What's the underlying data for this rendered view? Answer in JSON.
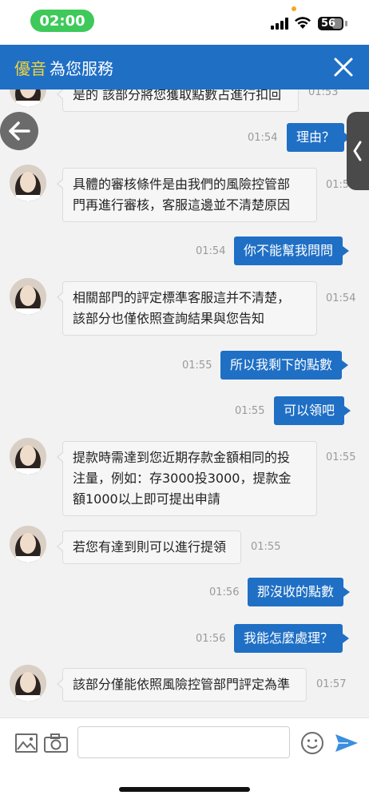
{
  "status_bar": {
    "time": "02:00",
    "battery": "56"
  },
  "header": {
    "brand": "優音",
    "title": "為您服務"
  },
  "messages": [
    {
      "from": "agent",
      "text": "是的 該部分將您獲取點數占進行扣回",
      "time": "01:53"
    },
    {
      "from": "user",
      "text": "理由？",
      "time": "01:54"
    },
    {
      "from": "agent",
      "text": "具體的審核條件是由我們的風險控管部門再進行審核，客服這邊並不清楚原因",
      "line1": "具體的審核條件是由我們的風險控管部",
      "line2": "門再進行審核，客服這邊並不清楚原因",
      "time": "01:54"
    },
    {
      "from": "user",
      "text": "你不能幫我問問",
      "time": "01:54"
    },
    {
      "from": "agent",
      "line1": "相關部門的評定標準客服這并不清楚，",
      "line2": "該部分也僅依照查詢結果與您告知",
      "time": "01:54"
    },
    {
      "from": "user",
      "text": "所以我剩下的點數",
      "time": "01:55"
    },
    {
      "from": "user",
      "text": "可以領吧",
      "time": "01:55"
    },
    {
      "from": "agent",
      "line1": "提款時需達到您近期存款金額相同的投",
      "line2": "注量，例如：存3000投3000，提款金",
      "line3": "額1000以上即可提出申請",
      "time": "01:55"
    },
    {
      "from": "agent",
      "text": "若您有達到則可以進行提領",
      "time": "01:55"
    },
    {
      "from": "user",
      "text": "那沒收的點數",
      "time": "01:56"
    },
    {
      "from": "user",
      "text": "我能怎麼處理？",
      "time": "01:56"
    },
    {
      "from": "agent",
      "text": "該部分僅能依照風險控管部門評定為準",
      "time": "01:57"
    }
  ],
  "input": {
    "placeholder": ""
  },
  "colors": {
    "primary": "#1f6fc5",
    "brand": "#f2d33c",
    "time_pill": "#3ec95a"
  },
  "icons": [
    "back-arrow-icon",
    "image-icon",
    "camera-icon",
    "emoji-icon",
    "send-icon",
    "close-icon",
    "chevron-left-icon"
  ]
}
